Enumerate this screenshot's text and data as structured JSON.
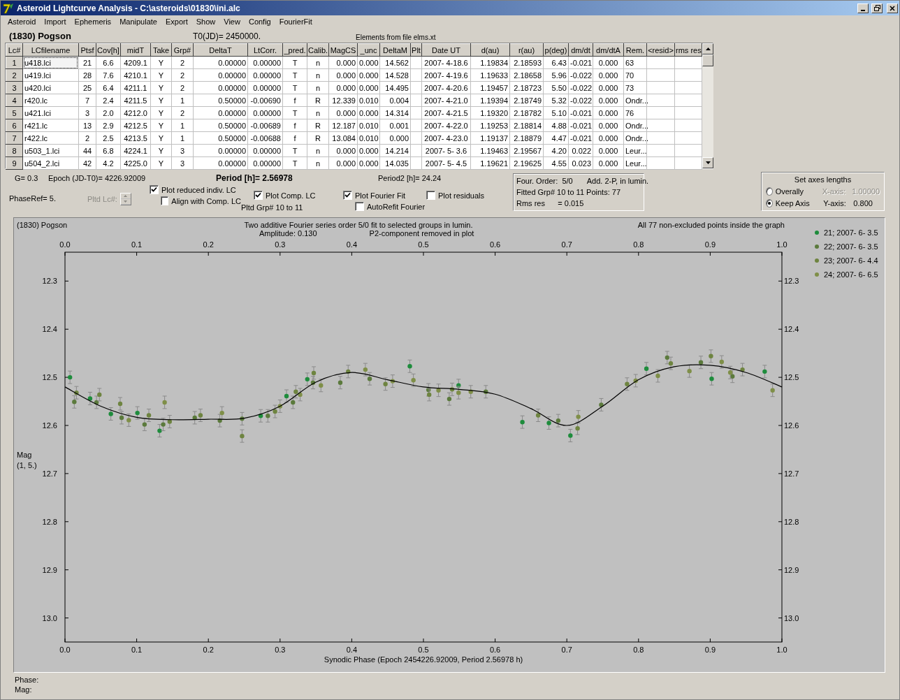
{
  "window": {
    "title": "Asteroid Lightcurve Analysis - C:\\asteroids\\01830\\ini.alc"
  },
  "menu": [
    "Asteroid",
    "Import",
    "Ephemeris",
    "Manipulate",
    "Export",
    "Show",
    "View",
    "Config",
    "FourierFit"
  ],
  "header": {
    "asteroid": "(1830) Pogson",
    "t0": "T0(JD)= 2450000.",
    "elements": "Elements from file elms.xt"
  },
  "table": {
    "columns": [
      "Lc#",
      "LCfilename",
      "Ptsf",
      "Cov[h]",
      "midT",
      "Take",
      "Grp#",
      "DeltaT",
      "LtCorr.",
      "_pred.",
      "Calib.",
      "MagCS",
      "_unc",
      "DeltaM",
      "Plt",
      "Date UT",
      "d(au)",
      "r(au)",
      "p(deg)",
      "dm/dt",
      "dm/dtA",
      "Rem.",
      "<resid>",
      "rms res"
    ],
    "rows": [
      {
        "focused": true,
        "cells": [
          "1",
          "u418.lci",
          "21",
          "6.6",
          "4209.1",
          "Y",
          "2",
          "0.00000",
          "0.00000",
          "T",
          "n",
          "0.000",
          "0.000",
          "14.562",
          "",
          "2007- 4-18.6",
          "1.19834",
          "2.18593",
          "6.43",
          "-0.021",
          "0.000",
          "63",
          "",
          ""
        ]
      },
      {
        "focused": false,
        "cells": [
          "2",
          "u419.lci",
          "28",
          "7.6",
          "4210.1",
          "Y",
          "2",
          "0.00000",
          "0.00000",
          "T",
          "n",
          "0.000",
          "0.000",
          "14.528",
          "",
          "2007- 4-19.6",
          "1.19633",
          "2.18658",
          "5.96",
          "-0.022",
          "0.000",
          "70",
          "",
          ""
        ]
      },
      {
        "focused": false,
        "cells": [
          "3",
          "u420.lci",
          "25",
          "6.4",
          "4211.1",
          "Y",
          "2",
          "0.00000",
          "0.00000",
          "T",
          "n",
          "0.000",
          "0.000",
          "14.495",
          "",
          "2007- 4-20.6",
          "1.19457",
          "2.18723",
          "5.50",
          "-0.022",
          "0.000",
          "73",
          "",
          ""
        ]
      },
      {
        "focused": false,
        "cells": [
          "4",
          "r420.lc",
          "7",
          "2.4",
          "4211.5",
          "Y",
          "1",
          "0.50000",
          "-0.00690",
          "f",
          "R",
          "12.339",
          "0.010",
          "0.004",
          "",
          "2007- 4-21.0",
          "1.19394",
          "2.18749",
          "5.32",
          "-0.022",
          "0.000",
          "Ondr...",
          "",
          ""
        ]
      },
      {
        "focused": false,
        "cells": [
          "5",
          "u421.lci",
          "3",
          "2.0",
          "4212.0",
          "Y",
          "2",
          "0.00000",
          "0.00000",
          "T",
          "n",
          "0.000",
          "0.000",
          "14.314",
          "",
          "2007- 4-21.5",
          "1.19320",
          "2.18782",
          "5.10",
          "-0.021",
          "0.000",
          "76",
          "",
          ""
        ]
      },
      {
        "focused": false,
        "cells": [
          "6",
          "r421.lc",
          "13",
          "2.9",
          "4212.5",
          "Y",
          "1",
          "0.50000",
          "-0.00689",
          "f",
          "R",
          "12.187",
          "0.010",
          "0.001",
          "",
          "2007- 4-22.0",
          "1.19253",
          "2.18814",
          "4.88",
          "-0.021",
          "0.000",
          "Ondr...",
          "",
          ""
        ]
      },
      {
        "focused": false,
        "cells": [
          "7",
          "r422.lc",
          "2",
          "2.5",
          "4213.5",
          "Y",
          "1",
          "0.50000",
          "-0.00688",
          "f",
          "R",
          "13.084",
          "0.010",
          "0.000",
          "",
          "2007- 4-23.0",
          "1.19137",
          "2.18879",
          "4.47",
          "-0.021",
          "0.000",
          "Ondr...",
          "",
          ""
        ]
      },
      {
        "focused": false,
        "cells": [
          "8",
          "u503_1.lci",
          "44",
          "6.8",
          "4224.1",
          "Y",
          "3",
          "0.00000",
          "0.00000",
          "T",
          "n",
          "0.000",
          "0.000",
          "14.214",
          "",
          "2007- 5- 3.6",
          "1.19463",
          "2.19567",
          "4.20",
          "0.022",
          "0.000",
          "Leur...",
          "",
          ""
        ]
      },
      {
        "focused": false,
        "cells": [
          "9",
          "u504_2.lci",
          "42",
          "4.2",
          "4225.0",
          "Y",
          "3",
          "0.00000",
          "0.00000",
          "T",
          "n",
          "0.000",
          "0.000",
          "14.035",
          "",
          "2007- 5- 4.5",
          "1.19621",
          "2.19625",
          "4.55",
          "0.023",
          "0.000",
          "Leur...",
          "",
          ""
        ]
      }
    ]
  },
  "params": {
    "g": "G= 0.3",
    "epoch": "Epoch (JD-T0)= 4226.92009",
    "period": "Period [h]= 2.56978",
    "period2": "Period2 [h]= 24.24",
    "phase_ref": "PhaseRef= 5.",
    "pltd_lc": {
      "label": "Pltd Lc#:",
      "disabled": true
    },
    "pltd_grp": "Pltd Grp#  10 to   11"
  },
  "checkboxes": [
    {
      "label": "Plot reduced indiv. LC",
      "checked": true
    },
    {
      "label": "Align with Comp. LC",
      "checked": false
    },
    {
      "label": "Plot Comp. LC",
      "checked": true
    },
    {
      "label": "Plot Fourier Fit",
      "checked": true
    },
    {
      "label": "AutoRefit Fourier",
      "checked": false
    },
    {
      "label": "Plot residuals",
      "checked": false
    }
  ],
  "fit_info": [
    [
      "Four. Order:  5/0",
      "Add. 2-P, in lumin."
    ],
    [
      "Fitted Grp# 10 to 11 Points: 77"
    ],
    [
      "Rms res      = 0.015"
    ]
  ],
  "axes": {
    "title": "Set axes lengths",
    "options": [
      {
        "label": "Overally",
        "selected": false,
        "axis_label": "X-axis:",
        "value": "1.00000",
        "disabled": true
      },
      {
        "label": "Keep Axis",
        "selected": true,
        "axis_label": "Y-axis:",
        "value": "0.800",
        "disabled": false
      }
    ]
  },
  "plot": {
    "object": "(1830) Pogson",
    "subtitle": "Two additive Fourier series order 5/0 fit to selected groups in lumin.",
    "amplitude": "Amplitude: 0.130",
    "p2_note": "P2-component removed in plot",
    "note": "All 77 non-excluded points inside the graph",
    "ylabel_units": "(1, 5.)",
    "chart_data": {
      "type": "scatter",
      "xlabel": "Synodic Phase (Epoch 2454226.92009, Period 2.56978 h)",
      "ylabel": "Mag",
      "xlim": [
        0,
        1
      ],
      "ylim": [
        13.05,
        12.24
      ],
      "xticks": [
        {
          "value": 0,
          "label": "0.0"
        },
        {
          "value": 0.1,
          "label": "0.1"
        },
        {
          "value": 0.2,
          "label": "0.2"
        },
        {
          "value": 0.3,
          "label": "0.3"
        },
        {
          "value": 0.4,
          "label": "0.4"
        },
        {
          "value": 0.5,
          "label": "0.5"
        },
        {
          "value": 0.6,
          "label": "0.6"
        },
        {
          "value": 0.7,
          "label": "0.7"
        },
        {
          "value": 0.8,
          "label": "0.8"
        },
        {
          "value": 0.9,
          "label": "0.9"
        },
        {
          "value": 1,
          "label": "1.0"
        }
      ],
      "yticks": [
        {
          "value": 12.3,
          "label": "12.3"
        },
        {
          "value": 12.4,
          "label": "12.4"
        },
        {
          "value": 12.5,
          "label": "12.5"
        },
        {
          "value": 12.6,
          "label": "12.6"
        },
        {
          "value": 12.7,
          "label": "12.7"
        },
        {
          "value": 12.8,
          "label": "12.8"
        },
        {
          "value": 12.9,
          "label": "12.9"
        },
        {
          "value": 13.0,
          "label": "13.0"
        }
      ],
      "series": [
        {
          "name": "21; 2007- 6- 3.5",
          "color": "#1e8c3c",
          "x": [
            0.007,
            0.035,
            0.064,
            0.101,
            0.132,
            0.273,
            0.309,
            0.338,
            0.481,
            0.549,
            0.638,
            0.675,
            0.705,
            0.811,
            0.902,
            0.976
          ],
          "values": [
            12.5,
            12.544,
            12.576,
            12.574,
            12.611,
            12.58,
            12.539,
            12.504,
            12.477,
            12.517,
            12.593,
            12.595,
            12.621,
            12.482,
            12.503,
            12.488
          ]
        },
        {
          "name": "22; 2007- 6- 3.5",
          "color": "#5b7a3c",
          "x": [
            0.013,
            0.044,
            0.079,
            0.111,
            0.137,
            0.181,
            0.216,
            0.247,
            0.283,
            0.318,
            0.346,
            0.384,
            0.425,
            0.507,
            0.536,
            0.587,
            0.688,
            0.748,
            0.84,
            0.887,
            0.931
          ],
          "values": [
            12.551,
            12.552,
            12.584,
            12.598,
            12.598,
            12.584,
            12.59,
            12.586,
            12.58,
            12.552,
            12.511,
            12.511,
            12.503,
            12.526,
            12.545,
            12.53,
            12.59,
            12.557,
            12.459,
            12.469,
            12.498
          ]
        },
        {
          "name": "23; 2007- 6- 4.4",
          "color": "#6e8440",
          "x": [
            0.016,
            0.048,
            0.077,
            0.117,
            0.146,
            0.189,
            0.247,
            0.293,
            0.322,
            0.347,
            0.395,
            0.447,
            0.508,
            0.54,
            0.66,
            0.715,
            0.784,
            0.845,
            0.901,
            0.945
          ],
          "values": [
            12.532,
            12.536,
            12.555,
            12.579,
            12.592,
            12.579,
            12.622,
            12.571,
            12.53,
            12.491,
            12.488,
            12.514,
            12.536,
            12.525,
            12.579,
            12.606,
            12.514,
            12.471,
            12.456,
            12.484
          ]
        },
        {
          "name": "24; 2007- 6- 6.5",
          "color": "#7f8f48",
          "x": [
            0.089,
            0.139,
            0.219,
            0.3,
            0.328,
            0.357,
            0.419,
            0.457,
            0.486,
            0.521,
            0.549,
            0.566,
            0.716,
            0.796,
            0.827,
            0.871,
            0.916,
            0.928,
            0.987
          ],
          "values": [
            12.589,
            12.552,
            12.574,
            12.56,
            12.536,
            12.517,
            12.484,
            12.508,
            12.506,
            12.527,
            12.532,
            12.53,
            12.582,
            12.507,
            12.497,
            12.487,
            12.468,
            12.49,
            12.527
          ]
        },
        {
          "type": "line",
          "color": "#000000",
          "x": [
            0,
            0.05,
            0.1,
            0.15,
            0.2,
            0.25,
            0.3,
            0.35,
            0.4,
            0.45,
            0.5,
            0.55,
            0.6,
            0.65,
            0.7,
            0.75,
            0.8,
            0.85,
            0.9,
            0.95,
            1
          ],
          "values": [
            12.52,
            12.56,
            12.583,
            12.588,
            12.587,
            12.585,
            12.56,
            12.51,
            12.49,
            12.505,
            12.52,
            12.525,
            12.535,
            12.565,
            12.6,
            12.56,
            12.505,
            12.478,
            12.475,
            12.49,
            12.52
          ]
        }
      ]
    }
  },
  "status": {
    "phase": "Phase:",
    "mag": "Mag:"
  }
}
